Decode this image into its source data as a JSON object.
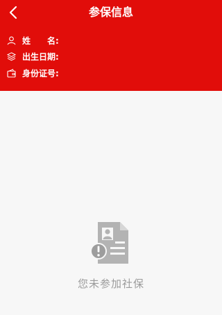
{
  "nav": {
    "title": "参保信息",
    "back_icon": "chevron-left-icon"
  },
  "info": {
    "name_label_part1": "姓",
    "name_label_part2": "名:",
    "name_value": "",
    "birth_label": "出生日期:",
    "birth_value": "",
    "id_label": "身份证号:",
    "id_value": ""
  },
  "empty_state": {
    "icon": "document-warning-icon",
    "message": "您未参加社保"
  },
  "colors": {
    "header_bg": "#e10d0a",
    "page_bg": "#f7f7f7",
    "empty_text": "#9b9b9b",
    "empty_icon": "#b3b3b3"
  }
}
